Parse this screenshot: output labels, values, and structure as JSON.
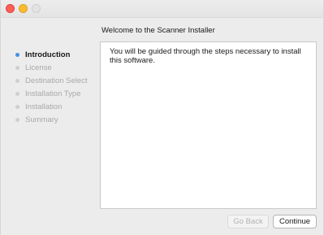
{
  "window": {
    "heading": "Welcome to the Scanner Installer"
  },
  "sidebar": {
    "steps": [
      {
        "label": "Introduction",
        "active": true
      },
      {
        "label": "License",
        "active": false
      },
      {
        "label": "Destination Select",
        "active": false
      },
      {
        "label": "Installation Type",
        "active": false
      },
      {
        "label": "Installation",
        "active": false
      },
      {
        "label": "Summary",
        "active": false
      }
    ]
  },
  "content": {
    "body_text": "You will be guided through the steps necessary to install this software."
  },
  "buttons": {
    "go_back": "Go Back",
    "continue": "Continue"
  },
  "colors": {
    "active_step_dot": "#4a90e2",
    "close": "#fc5f57",
    "minimize": "#fdbc2e",
    "zoom_inactive": "#e3e3e3"
  }
}
